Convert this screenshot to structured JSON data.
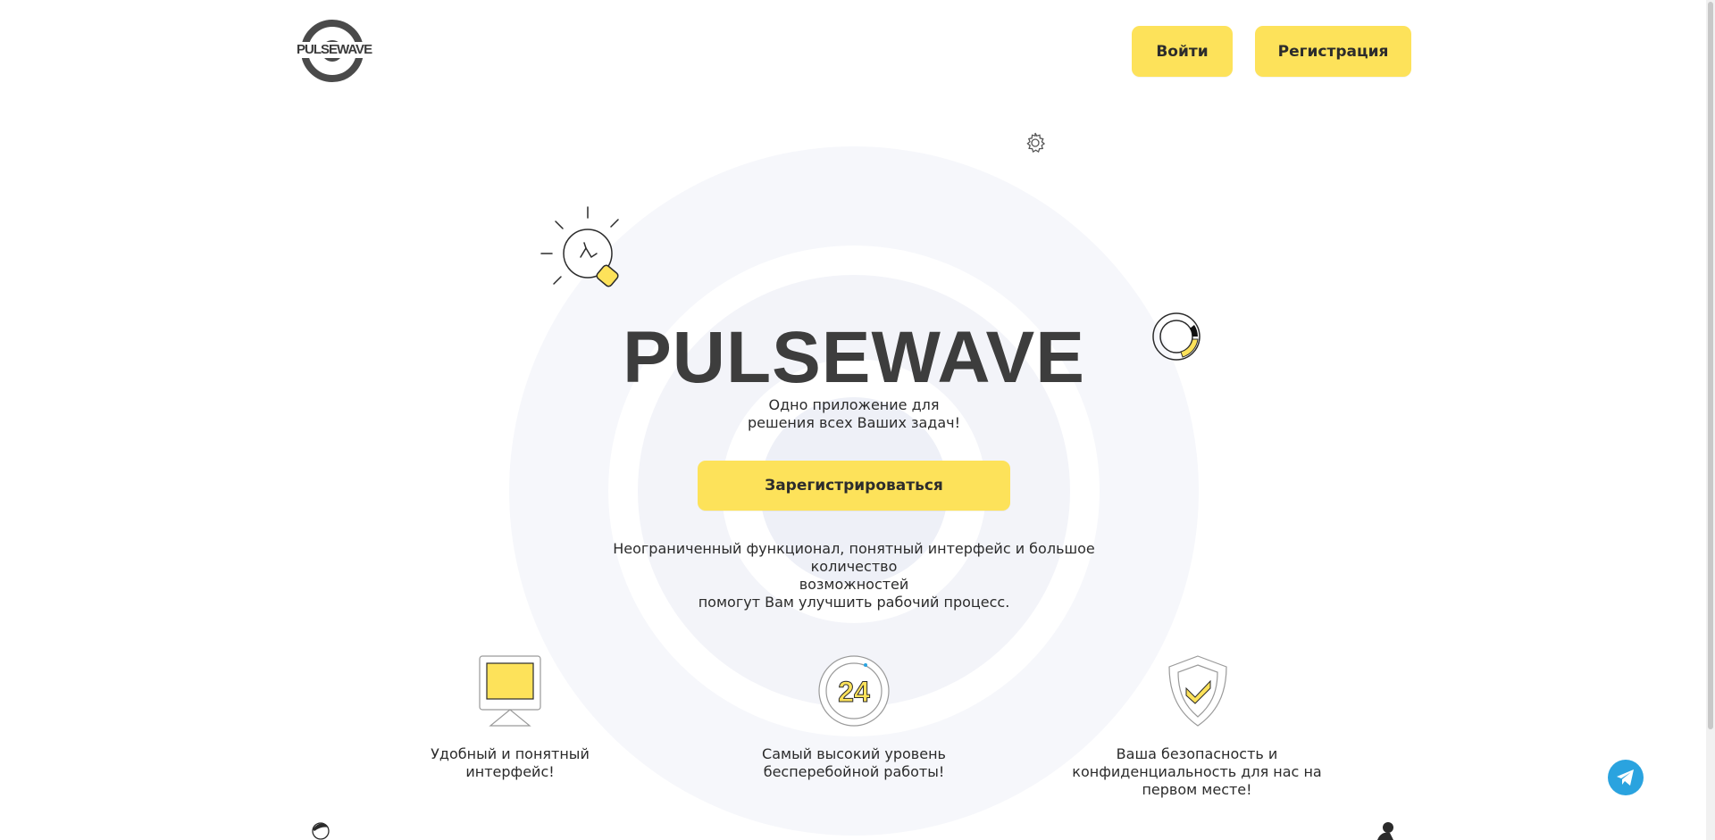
{
  "brand": {
    "logo_text": "PULSEWAVE"
  },
  "header": {
    "login_label": "Войти",
    "register_label": "Регистрация"
  },
  "hero": {
    "title": "PULSEWAVE",
    "subtitle_line1": "Одно приложение для",
    "subtitle_line2": "решения всех Ваших задач!",
    "cta_label": "Зарегистрироваться",
    "desc_line1": "Неограниченный функционал, понятный интерфейс и большое количество",
    "desc_line2": "возможностей",
    "desc_line3": "помогут Вам улучшить рабочий процесс."
  },
  "features": [
    {
      "icon": "monitor-icon",
      "line1": "Удобный и понятный интерфейс!",
      "line2": "",
      "line3": ""
    },
    {
      "icon": "clock-24-icon",
      "line1": "Самый высокий уровень",
      "line2": "бесперебойной работы!",
      "line3": ""
    },
    {
      "icon": "shield-check-icon",
      "line1": "Ваша безопасность и",
      "line2": "конфиденциальность для нас на",
      "line3": "первом месте!"
    }
  ],
  "colors": {
    "accent": "#fde25a",
    "text": "#2b2b2b",
    "title": "#3d3d3d",
    "rings": "#f3f4f9",
    "telegram": "#2aa3df"
  }
}
